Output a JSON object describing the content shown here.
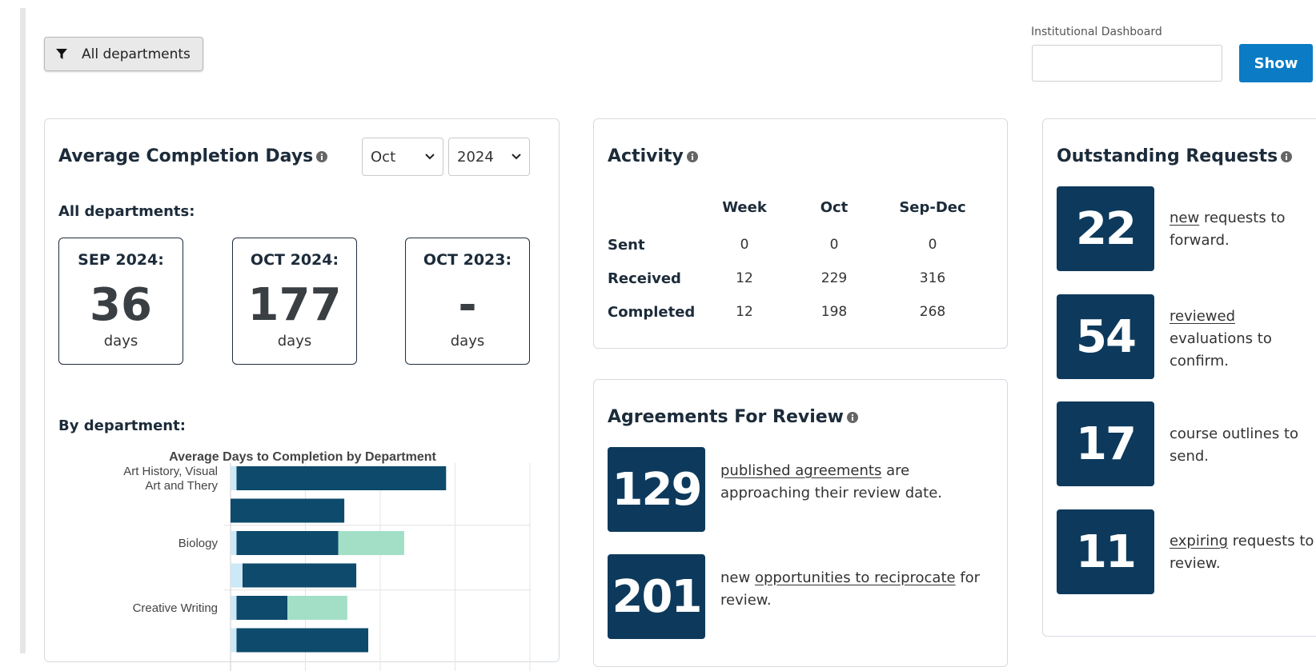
{
  "filter": {
    "label": "All departments",
    "icon": "filter-icon"
  },
  "dashboard": {
    "label": "Institutional Dashboard",
    "input_value": "",
    "show_label": "Show"
  },
  "avg_completion": {
    "title": "Average Completion Days",
    "month_select": "Oct",
    "year_select": "2024",
    "all_label": "All departments:",
    "stats": [
      {
        "label": "SEP 2024:",
        "value": "36",
        "unit": "days"
      },
      {
        "label": "OCT 2024:",
        "value": "177",
        "unit": "days"
      },
      {
        "label": "OCT 2023:",
        "value": "-",
        "unit": "days"
      }
    ],
    "by_dept_label": "By department:"
  },
  "chart_data": {
    "type": "bar",
    "title": "Average Days to Completion by Department",
    "categories": [
      "Art History, Visual Art and Thery",
      "",
      "Biology",
      "",
      "Creative Writing",
      ""
    ],
    "series": [
      {
        "color": "#cde8f6",
        "values": [
          2,
          0,
          2,
          4,
          2,
          2
        ]
      },
      {
        "color": "#0d4a6c",
        "values": [
          70,
          38,
          34,
          38,
          17,
          44
        ]
      },
      {
        "color": "#a2dfc6",
        "values": [
          0,
          0,
          22,
          0,
          20,
          0
        ]
      }
    ],
    "xlim": [
      0,
      100
    ],
    "grid": true
  },
  "activity": {
    "title": "Activity",
    "columns": [
      "Week",
      "Oct",
      "Sep-Dec"
    ],
    "rows": [
      {
        "label": "Sent",
        "values": [
          "0",
          "0",
          "0"
        ]
      },
      {
        "label": "Received",
        "values": [
          "12",
          "229",
          "316"
        ]
      },
      {
        "label": "Completed",
        "values": [
          "12",
          "198",
          "268"
        ]
      }
    ]
  },
  "agreements": {
    "title": "Agreements For Review",
    "items": [
      {
        "value": "129",
        "link": "published agreements",
        "text": " are approaching their review date."
      },
      {
        "value": "201",
        "pre": "new ",
        "link": "opportunities to reciprocate",
        "text": " for review."
      }
    ]
  },
  "outstanding": {
    "title": "Outstanding Requests",
    "items": [
      {
        "value": "22",
        "link": "new",
        "text": " requests to forward."
      },
      {
        "value": "54",
        "link": "reviewed",
        "text": " evaluations to confirm."
      },
      {
        "value": "17",
        "link": "",
        "text": "course outlines to send."
      },
      {
        "value": "11",
        "link": "expiring",
        "text": " requests to review."
      }
    ]
  }
}
